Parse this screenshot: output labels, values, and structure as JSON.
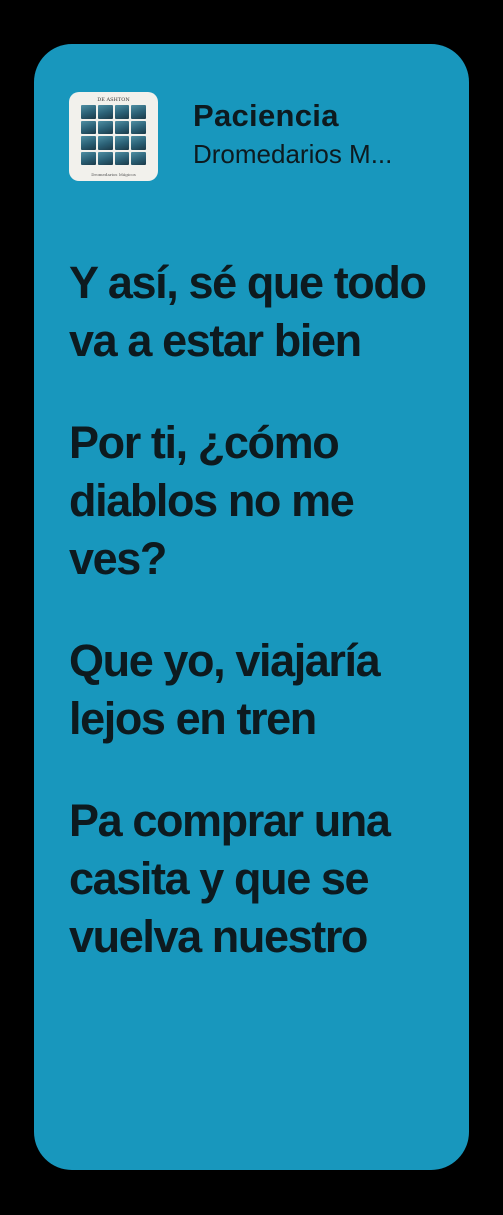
{
  "track": {
    "title": "Paciencia",
    "artist": "Dromedarios M...",
    "cover": {
      "label": "DE ASHTON",
      "sublabel": "Dromedarios Mágicos",
      "icon": "album-cover"
    }
  },
  "lyrics": [
    "Y así, sé que todo va a estar bien",
    "Por ti, ¿cómo diablos no me ves?",
    "Que yo, viajaría lejos en tren",
    "Pa comprar una casita y que se vuelva nuestro"
  ],
  "colors": {
    "background": "#000000",
    "card": "#1897bd",
    "text": "#0d1a1f"
  }
}
